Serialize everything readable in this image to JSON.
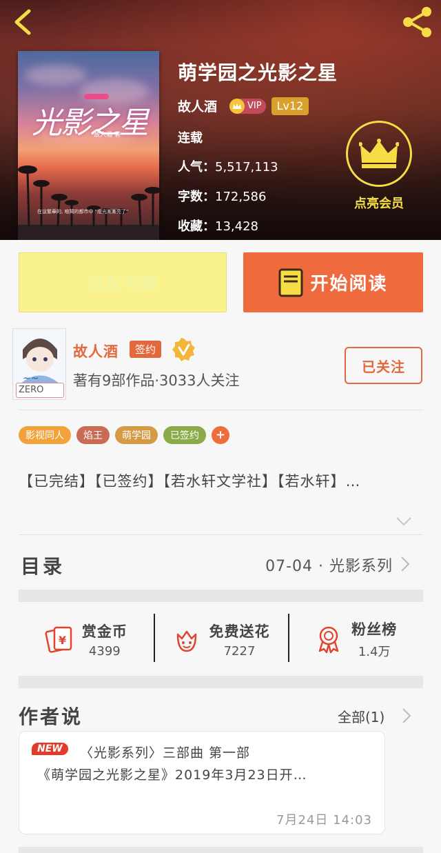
{
  "book": {
    "title": "萌学园之光影之星",
    "author": "故人酒",
    "vip_label": "VIP",
    "level": "Lv12",
    "status": "连载",
    "popularity_label": "人气：",
    "popularity": "5,517,113",
    "words_label": "字数：",
    "words": "172,586",
    "favorites_label": "收藏：",
    "favorites": "13,428",
    "cover": {
      "title": "光影之星",
      "author_line": "故人酒 著",
      "blurb": "在這繁華的, 喧鬧的都市中 \"燈光漸漸亮了\""
    }
  },
  "member": {
    "label": "点亮会员"
  },
  "actions": {
    "shelf_label": "已在书架",
    "read_label": "开始阅读"
  },
  "author": {
    "name": "故人酒",
    "sign_badge": "签约",
    "meta": "著有9部作品·3033人关注",
    "follow_label": "已关注",
    "avatar_caption": "ZERO"
  },
  "tags": [
    {
      "label": "影视同人",
      "color": "#f2a23a"
    },
    {
      "label": "焰王",
      "color": "#c96b55"
    },
    {
      "label": "萌学园",
      "color": "#d59a44"
    },
    {
      "label": "已签约",
      "color": "#8bab4b"
    }
  ],
  "tag_add": "+",
  "description": "【已完结】【已签约】【若水轩文学社】【若水轩】…",
  "catalog": {
    "label": "目录",
    "latest": "07-04 · 光影系列"
  },
  "stats": [
    {
      "title": "赏金币",
      "value": "4399",
      "icon": "reward-coin-icon"
    },
    {
      "title": "免费送花",
      "value": "7227",
      "icon": "flower-icon"
    },
    {
      "title": "粉丝榜",
      "value": "1.4万",
      "icon": "medal-icon"
    }
  ],
  "author_says": {
    "label": "作者说",
    "all_label": "全部(1)",
    "new_badge": "NEW",
    "line1": "〈光影系列〉三部曲  第一部",
    "line2": "《萌学园之光影之星》2019年3月23日开…",
    "date": "7月24日   14:03"
  },
  "colors": {
    "accent": "#ef6a3c",
    "shelf_button": "#faf28c",
    "gold": "#f6dd45"
  }
}
